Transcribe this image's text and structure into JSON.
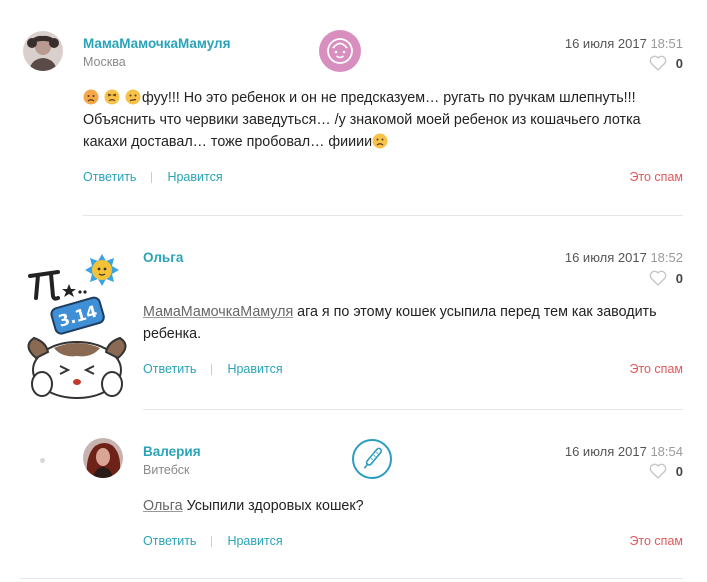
{
  "comments": [
    {
      "author": "МамаМамочкаМамуля",
      "city": "Москва",
      "date": "16 июля 2017",
      "time": "18:51",
      "likes": "0",
      "text_lines": [
        "фуу!!! Но это ребенок и он не предсказуем… ругать по ручкам шлепнуть!!!",
        "Объяснить что червики заведуться… /у знакомой моей ребенок из кошачьего лотка",
        "какахи доставал… тоже пробовал… фииии"
      ],
      "reply_label": "Ответить",
      "like_label": "Нравится",
      "spam_label": "Это спам"
    },
    {
      "author": "Ольга",
      "date": "16 июля 2017",
      "time": "18:52",
      "likes": "0",
      "mention": "МамаМамочкаМамуля",
      "text_line1": " ага я по этому кошек усыпила перед тем как заводить",
      "text_line2": "ребенка.",
      "reply_label": "Ответить",
      "like_label": "Нравится",
      "spam_label": "Это спам",
      "sticker_text": "3.14"
    },
    {
      "author": "Валерия",
      "city": "Витебск",
      "date": "16 июля 2017",
      "time": "18:54",
      "likes": "0",
      "mention": "Ольга",
      "text": " Усыпили здоровых кошек?",
      "reply_label": "Ответить",
      "like_label": "Нравится",
      "spam_label": "Это спам"
    }
  ],
  "icons": {
    "like": "heart-outline-icon",
    "badge1": "baby-face-badge-icon",
    "badge3": "thermometer-badge-icon",
    "emoji": "sad-face-emoji-icon"
  },
  "colors": {
    "link": "#2aa3b8",
    "spam": "#e2585a",
    "badge1": "#d88fc0",
    "badge3": "#2d9cc2"
  }
}
